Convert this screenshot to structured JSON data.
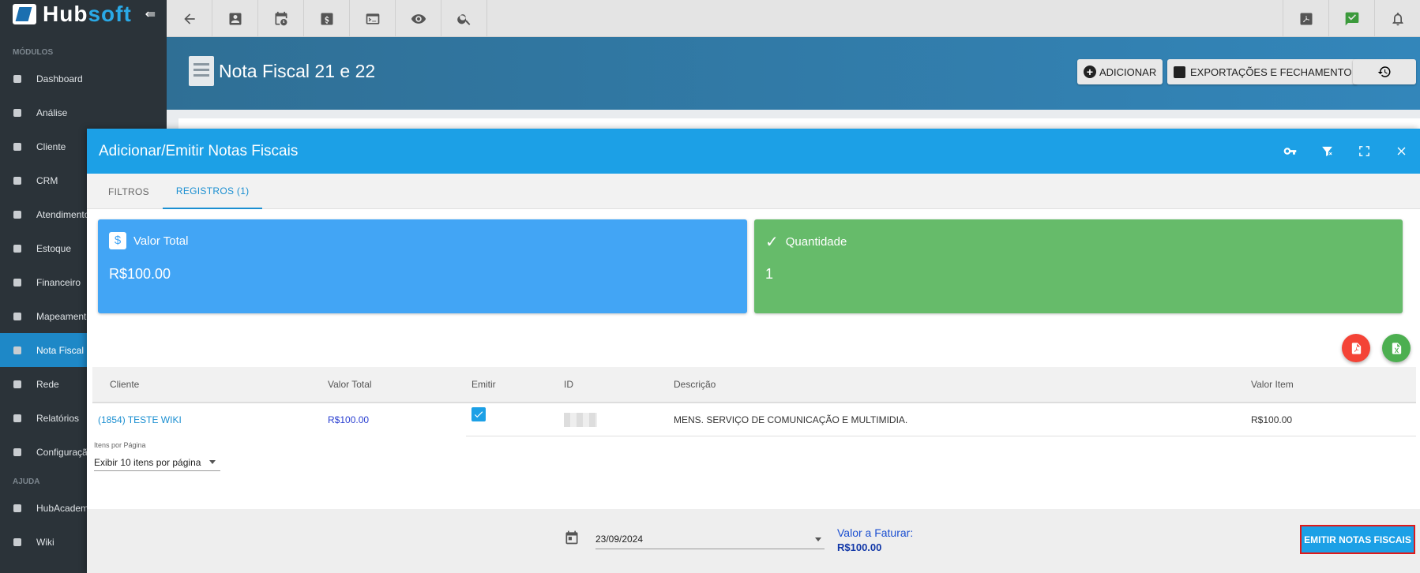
{
  "sidebar": {
    "brand_main": "Hub",
    "brand_accent": "soft",
    "section_modules": "MÓDULOS",
    "section_help": "AJUDA",
    "items": [
      {
        "label": "Dashboard",
        "icon": "dashboard-icon"
      },
      {
        "label": "Análise",
        "icon": "pie-chart-icon"
      },
      {
        "label": "Cliente",
        "icon": "contact-icon"
      },
      {
        "label": "CRM",
        "icon": "board-icon"
      },
      {
        "label": "Atendimento",
        "icon": "calendar-clock-icon"
      },
      {
        "label": "Estoque",
        "icon": "box-icon"
      },
      {
        "label": "Financeiro",
        "icon": "money-icon"
      },
      {
        "label": "Mapeamento",
        "icon": "map-pin-icon"
      },
      {
        "label": "Nota Fiscal",
        "icon": "document-icon",
        "active": true
      },
      {
        "label": "Rede",
        "icon": "server-icon"
      },
      {
        "label": "Relatórios",
        "icon": "report-icon"
      },
      {
        "label": "Configuração",
        "icon": "gear-icon"
      }
    ],
    "help_items": [
      {
        "label": "HubAcademy",
        "icon": "video-icon"
      },
      {
        "label": "Wiki",
        "icon": "wiki-icon"
      }
    ]
  },
  "header": {
    "title": "Nota Fiscal 21 e 22",
    "add_label": "ADICIONAR",
    "export_label": "EXPORTAÇÕES E FECHAMENTO"
  },
  "modal": {
    "title": "Adicionar/Emitir Notas Fiscais",
    "tabs": [
      "FILTROS",
      "REGISTROS (1)"
    ],
    "active_tab": 1,
    "cards": {
      "total_label": "Valor Total",
      "total_value": "R$100.00",
      "qty_label": "Quantidade",
      "qty_value": "1"
    },
    "table": {
      "columns": [
        "Cliente",
        "Valor Total",
        "Emitir",
        "ID",
        "Descrição",
        "Valor Item"
      ],
      "rows": [
        {
          "cliente": "(1854) TESTE WIKI",
          "valor_total": "R$100.00",
          "emitir": true,
          "id": "",
          "descricao": "MENS. SERVIÇO DE COMUNICAÇÃO E MULTIMIDIA.",
          "valor_item": "R$100.00"
        }
      ]
    },
    "pager": {
      "label": "Itens por Página",
      "value": "Exibir 10 itens por página"
    },
    "footer": {
      "date": "23/09/2024",
      "faturar_label": "Valor a Faturar:",
      "faturar_value": "R$100.00",
      "emit_label": "EMITIR NOTAS FISCAIS"
    }
  },
  "colors": {
    "sidebar": "#2b3339",
    "modal_header": "#1ca0e6",
    "card_blue": "#42a5f5",
    "card_green": "#66bb6a",
    "active_nav": "#1e88c7"
  }
}
